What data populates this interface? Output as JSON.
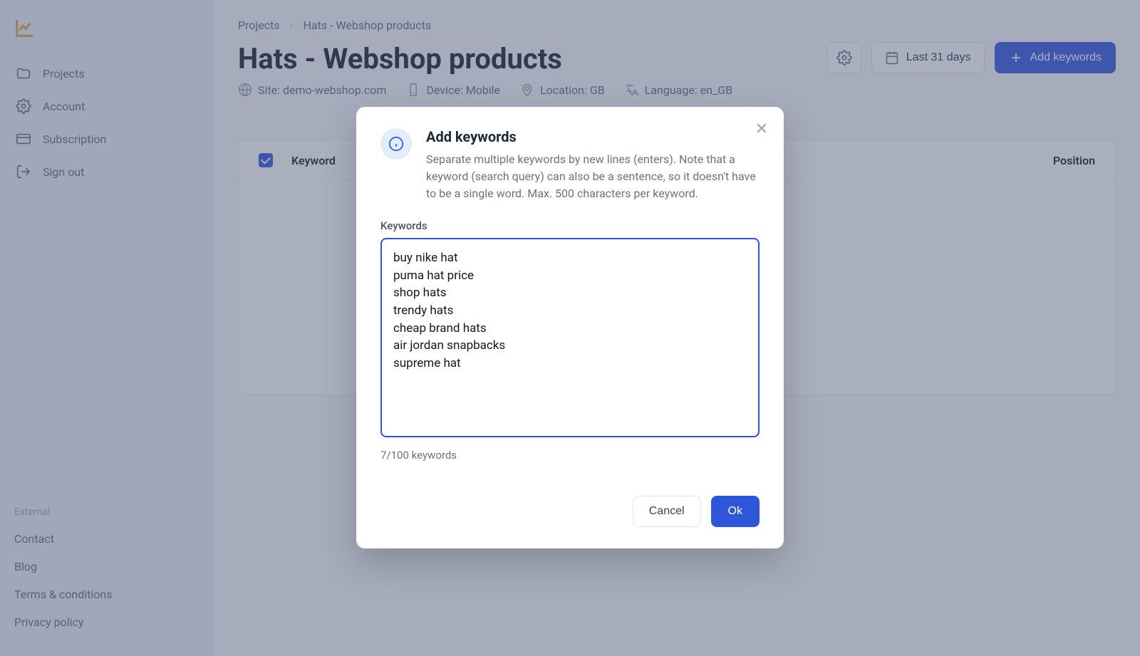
{
  "sidebar": {
    "items": [
      {
        "label": "Projects"
      },
      {
        "label": "Account"
      },
      {
        "label": "Subscription"
      },
      {
        "label": "Sign out"
      }
    ],
    "external_label": "External",
    "footer_links": [
      {
        "label": "Contact"
      },
      {
        "label": "Blog"
      },
      {
        "label": "Terms & conditions"
      },
      {
        "label": "Privacy policy"
      }
    ]
  },
  "breadcrumb": {
    "root": "Projects",
    "current": "Hats - Webshop products"
  },
  "page": {
    "title": "Hats - Webshop products",
    "site": "Site: demo-webshop.com",
    "device": "Device: Mobile",
    "location": "Location: GB",
    "language": "Language: en_GB"
  },
  "header_buttons": {
    "date_range": "Last 31 days",
    "add_keywords": "Add keywords"
  },
  "table": {
    "col_keyword": "Keyword",
    "col_position": "Position",
    "empty_hint": ")."
  },
  "modal": {
    "title": "Add keywords",
    "description": "Separate multiple keywords by new lines (enters). Note that a keyword (search query) can also be a sentence, so it doesn't have to be a single word. Max. 500 characters per keyword.",
    "field_label": "Keywords",
    "textarea_value": "buy nike hat\npuma hat price\nshop hats\ntrendy hats\ncheap brand hats\nair jordan snapbacks\nsupreme hat",
    "counter": "7/100 keywords",
    "cancel": "Cancel",
    "ok": "Ok"
  }
}
